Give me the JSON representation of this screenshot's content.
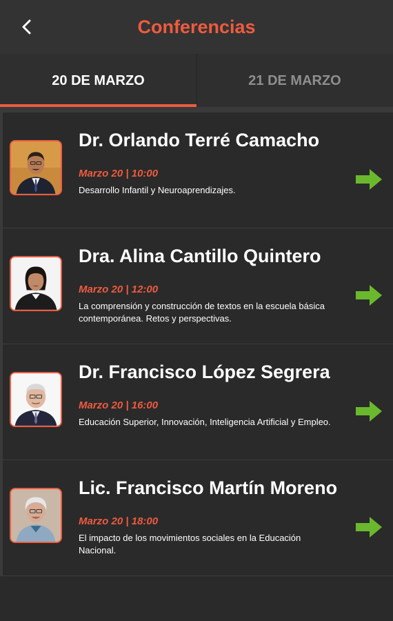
{
  "header": {
    "title": "Conferencias",
    "back_icon": "chevron-left-icon"
  },
  "tabs": [
    {
      "label": "20 DE MARZO",
      "active": true
    },
    {
      "label": "21 DE MARZO",
      "active": false
    }
  ],
  "colors": {
    "accent": "#ef5b3f",
    "arrow_green": "#6ab82e",
    "background": "#2a2a2a"
  },
  "speakers": [
    {
      "name": "Dr. Orlando Terré Camacho",
      "time": "Marzo 20 | 10:00",
      "description": "Desarrollo Infantil y Neuroaprendizajes."
    },
    {
      "name": "Dra. Alina Cantillo Quintero",
      "time": "Marzo 20 | 12:00",
      "description": "La comprensión y construcción de textos en la escuela básica contemporánea. Retos y perspectivas."
    },
    {
      "name": "Dr. Francisco López Segrera",
      "time": "Marzo 20 | 16:00",
      "description": "Educación Superior, Innovación, Inteligencia Artificial y Empleo."
    },
    {
      "name": "Lic. Francisco Martín Moreno",
      "time": "Marzo 20 | 18:00",
      "description": "El impacto de los movimientos sociales en la Educación Nacional."
    }
  ]
}
